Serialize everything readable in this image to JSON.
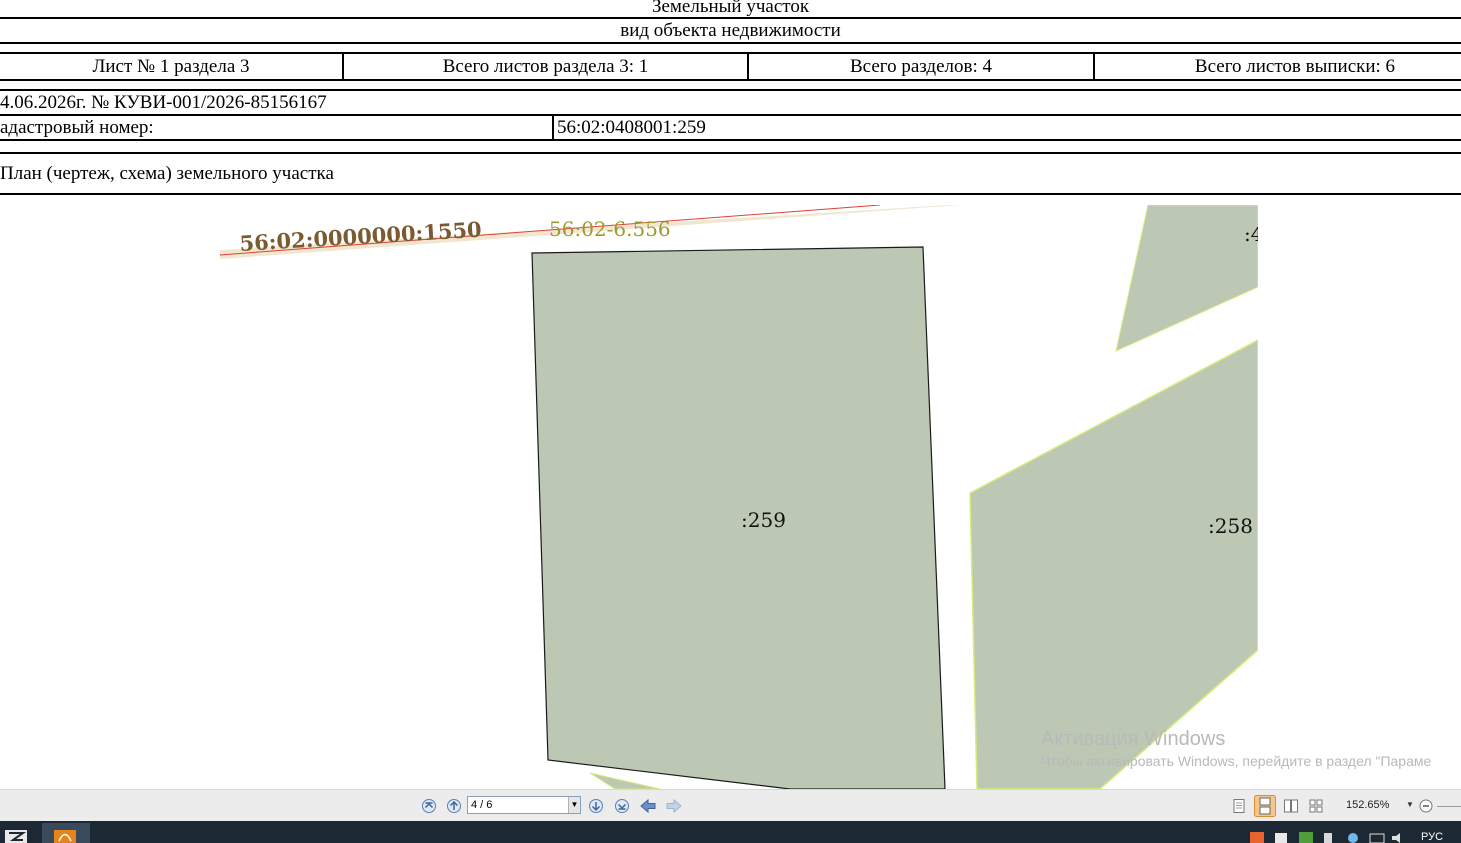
{
  "document": {
    "object_title": "Земельный участок",
    "object_subtitle": "вид объекта недвижимости",
    "sheet_info": {
      "sheet": "Лист № 1 раздела 3",
      "total_sheets_section": "Всего листов раздела 3: 1",
      "total_sections": "Всего разделов: 4",
      "total_sheets_extract": "Всего листов выписки: 6"
    },
    "date_number": "4.06.2026г. № КУВИ-001/2026-85156167",
    "cadastral_label": "адастровый номер:",
    "cadastral_value": "56:02:0408001:259",
    "plan_title": "План (чертеж, схема) земельного участка"
  },
  "map": {
    "road_label": "56:02:0000000:1550",
    "zone_label": "56:02-6.556",
    "parcel_main_label": ":259",
    "parcel_right_label": ":258",
    "parcel_top_label": ":4",
    "colors": {
      "parcel_fill": "#bdc8b4",
      "road_band": "#f1e6cf",
      "road_label": "#7b5a2f",
      "zone_label": "#9b9a2c",
      "zone_line": "#e0403a"
    }
  },
  "watermark": {
    "title": "Активация Windows",
    "subtitle": "Чтобы активировать Windows, перейдите в раздел \"Параме"
  },
  "viewer": {
    "page_indicator": "4 / 6",
    "zoom": "152.65%",
    "icons": [
      "first-page-icon",
      "prev-page-icon",
      "next-page-icon",
      "last-page-icon",
      "back-icon",
      "forward-icon",
      "single-page-icon",
      "continuous-icon",
      "facing-icon",
      "thumbnails-icon",
      "zoom-out-icon"
    ]
  },
  "taskbar": {
    "language": "РУС",
    "icons": [
      "start-icon",
      "app-icon",
      "tray-icons"
    ]
  }
}
